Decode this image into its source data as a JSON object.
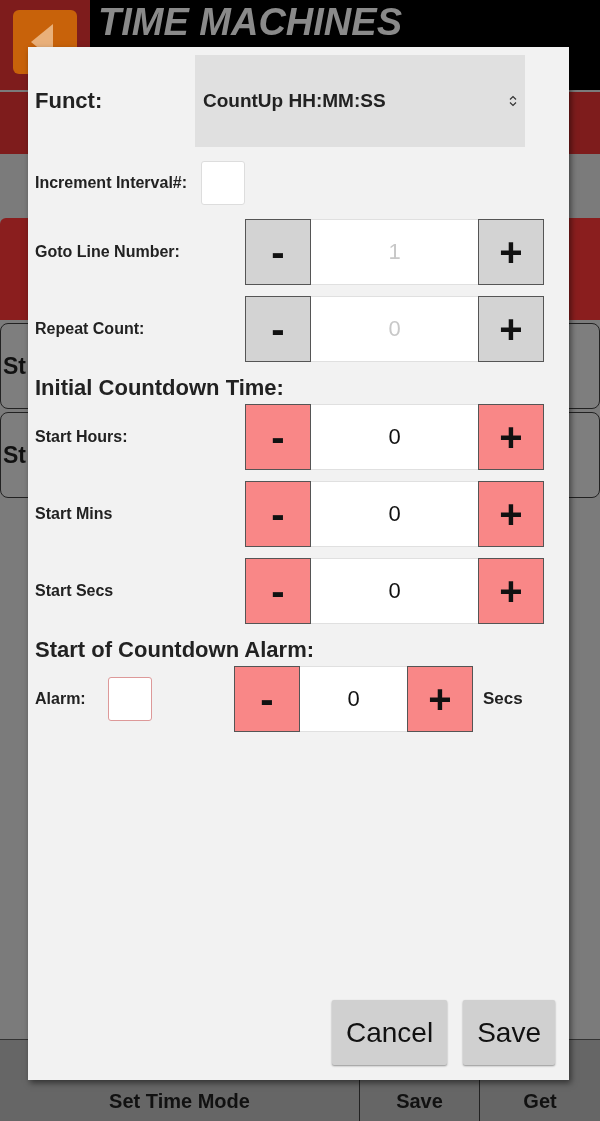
{
  "background": {
    "logo": "TIME MACHINES",
    "side_buttons": [
      "St",
      "St"
    ],
    "bottom_bar": [
      "Set Time Mode",
      "Save",
      "Get"
    ]
  },
  "dialog": {
    "funct": {
      "label": "Funct:",
      "value": "CountUp HH:MM:SS"
    },
    "rows": [
      {
        "kind": "checkbox",
        "label": "Increment Interval#:",
        "checked": false
      },
      {
        "kind": "stepper",
        "label": "Goto Line Number:",
        "minus": "-",
        "value": "1",
        "plus": "+",
        "disabled": true
      },
      {
        "kind": "stepper",
        "label": "Repeat Count:",
        "minus": "-",
        "value": "0",
        "plus": "+",
        "disabled": true
      },
      {
        "kind": "heading",
        "label": "Initial Countdown Time:"
      },
      {
        "kind": "stepper",
        "label": "Start Hours:",
        "minus": "-",
        "value": "0",
        "plus": "+",
        "disabled": false
      },
      {
        "kind": "stepper",
        "label": "Start Mins",
        "minus": "-",
        "value": "0",
        "plus": "+",
        "disabled": false
      },
      {
        "kind": "stepper",
        "label": "Start Secs",
        "minus": "-",
        "value": "0",
        "plus": "+",
        "disabled": false
      },
      {
        "kind": "heading",
        "label": "Start of Countdown Alarm:"
      },
      {
        "kind": "alarm",
        "label": "Alarm:",
        "checked": false,
        "minus": "-",
        "value": "0",
        "plus": "+",
        "unit": "Secs"
      }
    ],
    "buttons": [
      "Cancel",
      "Save"
    ]
  }
}
